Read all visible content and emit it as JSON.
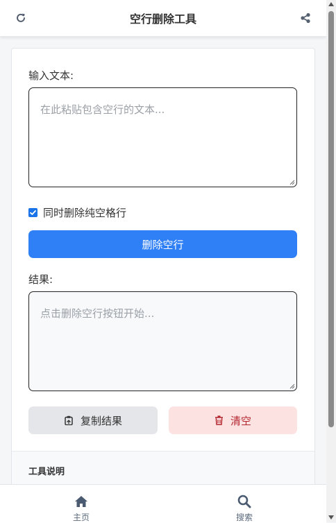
{
  "header": {
    "title": "空行删除工具",
    "refresh_icon": "refresh-icon",
    "share_icon": "share-icon"
  },
  "form": {
    "input_label": "输入文本:",
    "input_placeholder": "在此粘贴包含空行的文本...",
    "input_value": "",
    "checkbox_label": "同时删除纯空格行",
    "checkbox_checked": true,
    "delete_button_label": "删除空行",
    "result_label": "结果:",
    "result_placeholder": "点击删除空行按钮开始...",
    "result_value": "",
    "copy_button_label": "复制结果",
    "copy_icon": "clipboard-icon",
    "clear_button_label": "清空",
    "clear_icon": "trash-icon"
  },
  "info": {
    "title": "工具说明"
  },
  "bottom_nav": {
    "items": [
      {
        "label": "主页",
        "icon": "home-icon"
      },
      {
        "label": "搜索",
        "icon": "search-icon"
      }
    ]
  },
  "colors": {
    "primary": "#2f80f7",
    "danger_bg": "#fde2e2",
    "danger_text": "#b3262e",
    "nav_icon": "#4a5a70"
  }
}
